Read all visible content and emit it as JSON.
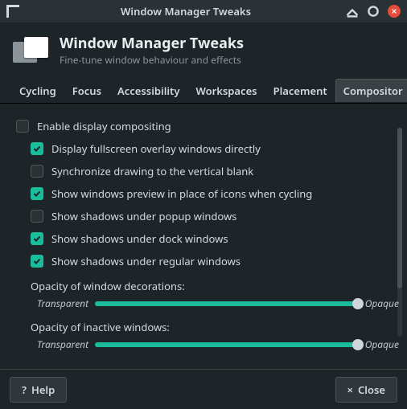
{
  "titlebar": {
    "title": "Window Manager Tweaks"
  },
  "header": {
    "title": "Window Manager Tweaks",
    "subtitle": "Fine-tune window behaviour and effects"
  },
  "tabs": {
    "items": [
      {
        "label": "Cycling"
      },
      {
        "label": "Focus"
      },
      {
        "label": "Accessibility"
      },
      {
        "label": "Workspaces"
      },
      {
        "label": "Placement"
      },
      {
        "label": "Compositor"
      }
    ],
    "active_index": 5
  },
  "options": {
    "enable_compositing": {
      "label": "Enable display compositing",
      "checked": false
    },
    "sub": [
      {
        "label": "Display fullscreen overlay windows directly",
        "checked": true
      },
      {
        "label": "Synchronize drawing to the vertical blank",
        "checked": false
      },
      {
        "label": "Show windows preview in place of icons when cycling",
        "checked": true
      },
      {
        "label": "Show shadows under popup windows",
        "checked": false
      },
      {
        "label": "Show shadows under dock windows",
        "checked": true
      },
      {
        "label": "Show shadows under regular windows",
        "checked": true
      }
    ]
  },
  "sliders": [
    {
      "label": "Opacity of window decorations:",
      "left": "Transparent",
      "right": "Opaque"
    },
    {
      "label": "Opacity of inactive windows:",
      "left": "Transparent",
      "right": "Opaque"
    }
  ],
  "footer": {
    "help": "Help",
    "close": "Close"
  },
  "colors": {
    "accent": "#1abc9c",
    "danger": "#e74c3c"
  }
}
